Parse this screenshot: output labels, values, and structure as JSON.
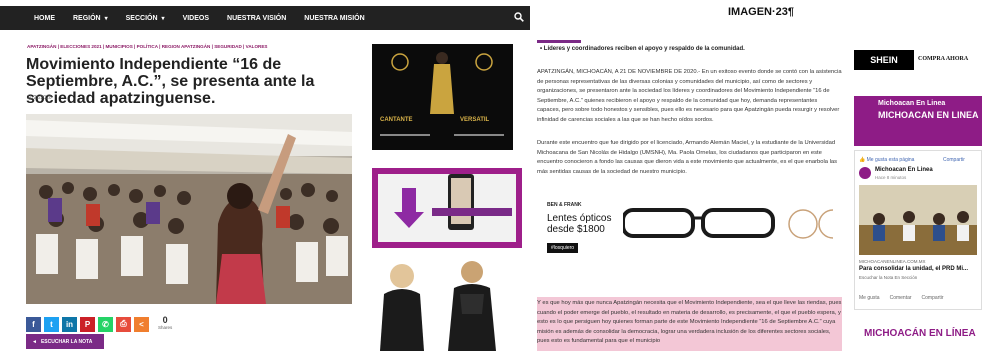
{
  "nav": {
    "items": [
      "HOME",
      "REGIÓN",
      "SECCIÓN",
      "VIDEOS",
      "NUESTRA VISIÓN",
      "NUESTRA MISIÓN"
    ]
  },
  "article": {
    "categories": "APATZINGÁN | ELECCIONES 2021 | MUNICIPIOS | POLÍTICA | REGION APATZINGÁN | SEGURIDAD | VALORES",
    "title": "Movimiento Independiente “16 de Septiembre, A.C.”, se presenta ante la sociedad apatzinguense.",
    "date": "11/21/2020",
    "share_count": "0",
    "share_label": "Shares",
    "listen_label": "ESCUCHAR LA NOTA"
  },
  "ads": {
    "singer_left": "CANTANTE",
    "singer_right": "VERSATIL"
  },
  "right": {
    "image_title": "IMAGEN·23¶",
    "bullet": "Líderes y coordinadores reciben el apoyo y respaldo de la comunidad.",
    "p1": "APATZINGÁN, MICHOACÁN, A 21 DE NOVIEMBRE DE 2020.- En un exitoso evento donde se contó con la asistencia de personas representativas de las diversas colonias y comunidades del municipio, así como de sectores y organizaciones, se presentaron ante la sociedad los líderes y coordinadores del Movimiento Independiente “16 de Septiembre, A.C.” quienes recibieron el apoyo y respaldo de la comunidad que hoy, demanda representantes capaces, pero sobre todo honestos y sensibles, pues ello es necesario para que Apatzingán pueda resurgir y resolver infinidad de carencias sociales a las que se han hecho oídos sordos.",
    "p2": "Durante este encuentro que fue dirigido por el licenciado, Armando Alemán Maciel, y la estudiante de la Universidad Michoacana de San Nicolás de Hidalgo (UMSNH), Ma. Paola Ornelas, los ciudadanos que participaron en este encuentro conocieron a fondo las causas que dieron vida a este movimiento que actualmente, es el que enarbola las más sentidas causas de la sociedad de nuestro municipio.",
    "p3": "Y es que hoy más que nunca Apatzingán necesita que el Movimiento Independiente, sea el que lleve las riendas, pues cuando el poder emerge del pueblo, el resultado en materia de desarrollo, es precisamente, el que el pueblo espera, y esto es lo que persiguen hoy quienes forman parte de este Movimiento Independiente “16 de Septiembre A.C.” cuya misión es además de consolidar la democracia, lograr una verdadera inclusión de los diferentes sectores sociales, pues esto es fundamental para que el municipio",
    "eye_ad": {
      "brand": "BEN & FRANK",
      "line1": "Lentes ópticos",
      "line2": "desde $1800",
      "tag": "#losquiero"
    },
    "shein": "SHEIN",
    "shein_cta": "COMPRA AHORA",
    "mich_title": "Michoacan En Linea",
    "mich_sub": "MICHOACAN EN LINEA",
    "fb_like": "Me gusta esta página",
    "fb_share": "Compartir",
    "fb_page": "Michoacan En Linea",
    "fb_time": "Hace 8 minutos",
    "fb_url": "MICHOACANENLINEA.COM.MX",
    "fb_headline": "Para consolidar la unidad, el PRD Mi...",
    "fb_listen": "Escuchar la Nota  En Sección",
    "fb_actions": [
      "Me gusta",
      "Comentar",
      "Compartir"
    ],
    "mich_bottom": "MICHOACÁN EN LÍNEA"
  }
}
